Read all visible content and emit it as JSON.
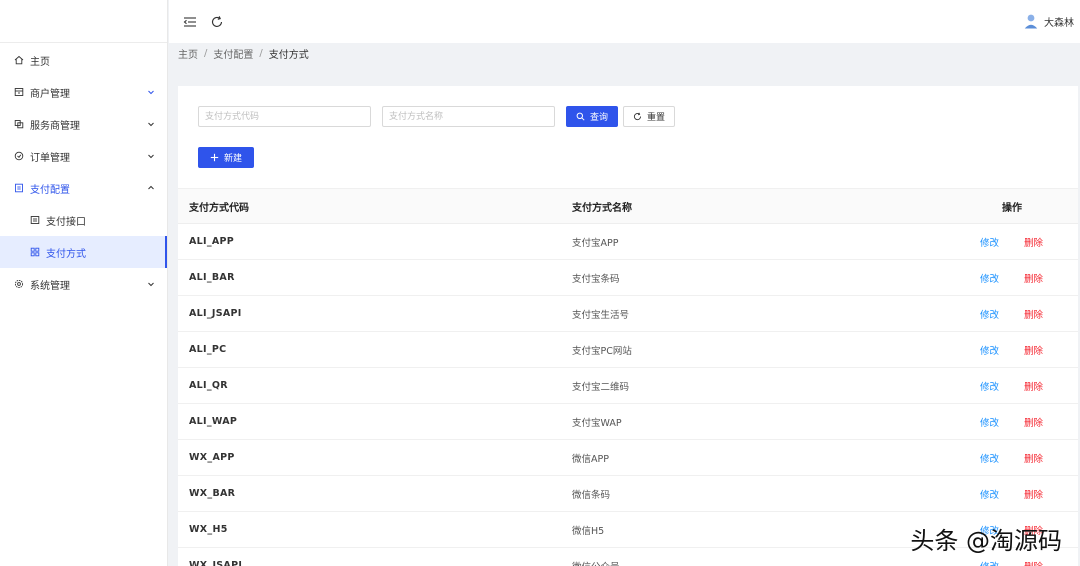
{
  "sidebar": {
    "items": [
      {
        "label": "主页",
        "icon": "home-icon"
      },
      {
        "label": "商户管理",
        "icon": "merchant-icon"
      },
      {
        "label": "服务商管理",
        "icon": "provider-icon"
      },
      {
        "label": "订单管理",
        "icon": "order-icon"
      },
      {
        "label": "支付配置",
        "icon": "payment-config-icon"
      },
      {
        "label": "支付接口",
        "icon": "interface-icon"
      },
      {
        "label": "支付方式",
        "icon": "grid-icon"
      },
      {
        "label": "系统管理",
        "icon": "settings-icon"
      }
    ]
  },
  "header": {
    "user_name": "大森林"
  },
  "breadcrumb": {
    "items": [
      "主页",
      "支付配置",
      "支付方式"
    ],
    "separator": "/"
  },
  "search": {
    "code_placeholder": "支付方式代码",
    "name_placeholder": "支付方式名称",
    "query_label": "查询",
    "reset_label": "重置",
    "new_label": "新建"
  },
  "table": {
    "headers": [
      "支付方式代码",
      "支付方式名称",
      "操作"
    ],
    "edit_label": "修改",
    "delete_label": "删除",
    "rows": [
      {
        "code": "ALI_APP",
        "name": "支付宝APP"
      },
      {
        "code": "ALI_BAR",
        "name": "支付宝条码"
      },
      {
        "code": "ALI_JSAPI",
        "name": "支付宝生活号"
      },
      {
        "code": "ALI_PC",
        "name": "支付宝PC网站"
      },
      {
        "code": "ALI_QR",
        "name": "支付宝二维码"
      },
      {
        "code": "ALI_WAP",
        "name": "支付宝WAP"
      },
      {
        "code": "WX_APP",
        "name": "微信APP"
      },
      {
        "code": "WX_BAR",
        "name": "微信条码"
      },
      {
        "code": "WX_H5",
        "name": "微信H5"
      },
      {
        "code": "WX_JSAPI",
        "name": "微信公众号"
      }
    ]
  },
  "watermark": "头条 @淘源码",
  "colors": {
    "primary": "#2f54eb",
    "link": "#1890ff",
    "danger": "#f5222d",
    "active_bg": "#e6edff"
  }
}
